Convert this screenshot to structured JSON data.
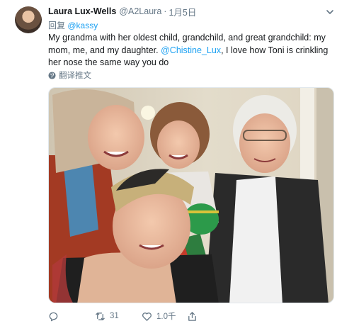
{
  "tweet": {
    "display_name": "Laura Lux-Wells",
    "handle": "@A2Laura",
    "separator": "·",
    "date": "1月5日",
    "reply_prefix": "回复",
    "reply_mention": "@kassy",
    "text_part1": "My grandma with her oldest child, grandchild, and great grandchild: my mom, me, and my daughter. ",
    "text_mention": "@Chistine_Lux",
    "text_part2": ", I love how Toni is crinkling her nose the same way you do",
    "translate_label": "翻译推文"
  },
  "actions": {
    "reply_count": "",
    "retweet_count": "31",
    "like_count": "1.0千",
    "share_count": ""
  },
  "colors": {
    "link": "#1da1f2",
    "secondary_text": "#657786",
    "primary_text": "#14171a"
  },
  "icons": [
    "chevron-down-icon",
    "globe-icon",
    "reply-icon",
    "retweet-icon",
    "like-icon",
    "share-icon"
  ]
}
